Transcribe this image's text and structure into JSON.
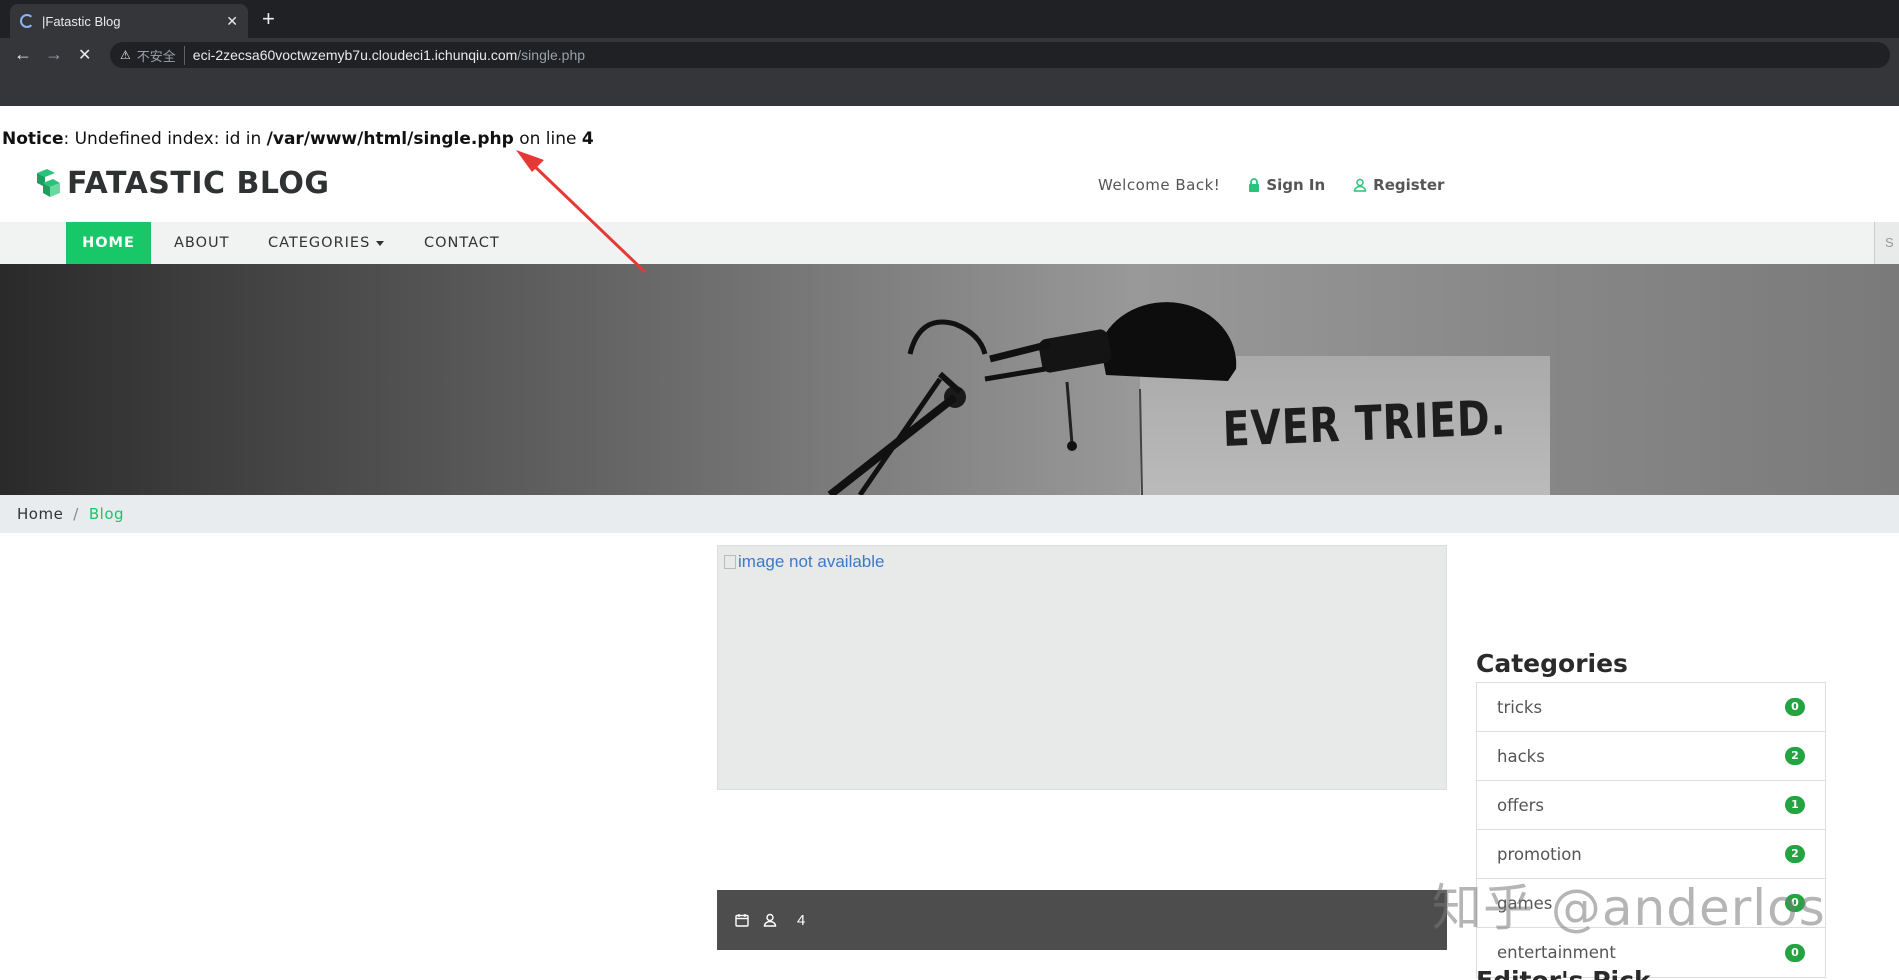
{
  "browser": {
    "tab_title": "|Fatastic Blog",
    "close_glyph": "✕",
    "new_tab_glyph": "+",
    "back_glyph": "←",
    "forward_glyph": "→",
    "stop_glyph": "✕",
    "insecure_icon": "⚠",
    "insecure_label": "不安全",
    "url_host": "eci-2zecsa60voctwzemyb7u.cloudeci1.ichunqiu.com",
    "url_path": "/single.php"
  },
  "notice": {
    "label": "Notice",
    "message": ": Undefined index: id in ",
    "file": "/var/www/html/single.php",
    "on_line": " on line ",
    "line": "4"
  },
  "header": {
    "brand": "FATASTIC BLOG",
    "welcome": "Welcome Back!",
    "sign_in": "Sign In",
    "register": "Register"
  },
  "nav": {
    "home": "HOME",
    "about": "ABOUT",
    "categories": "CATEGORIES",
    "contact": "CONTACT",
    "search_stub": "S"
  },
  "hero": {
    "text": "EVER TRIED."
  },
  "breadcrumb": {
    "home": "Home",
    "separator": "/",
    "current": "Blog"
  },
  "post": {
    "image_alt": "image not available",
    "meta_value": "4"
  },
  "sidebar": {
    "title": "Categories",
    "categories": [
      {
        "name": "tricks",
        "count": "0"
      },
      {
        "name": "hacks",
        "count": "2"
      },
      {
        "name": "offers",
        "count": "1"
      },
      {
        "name": "promotion",
        "count": "2"
      },
      {
        "name": "games",
        "count": "0"
      },
      {
        "name": "entertainment",
        "count": "0"
      }
    ],
    "next_heading": "Editor's Pick"
  },
  "watermark": "知乎 @anderlos",
  "colors": {
    "accent": "#18c768",
    "badge": "#23a441",
    "annotation_arrow": "#e53935"
  }
}
